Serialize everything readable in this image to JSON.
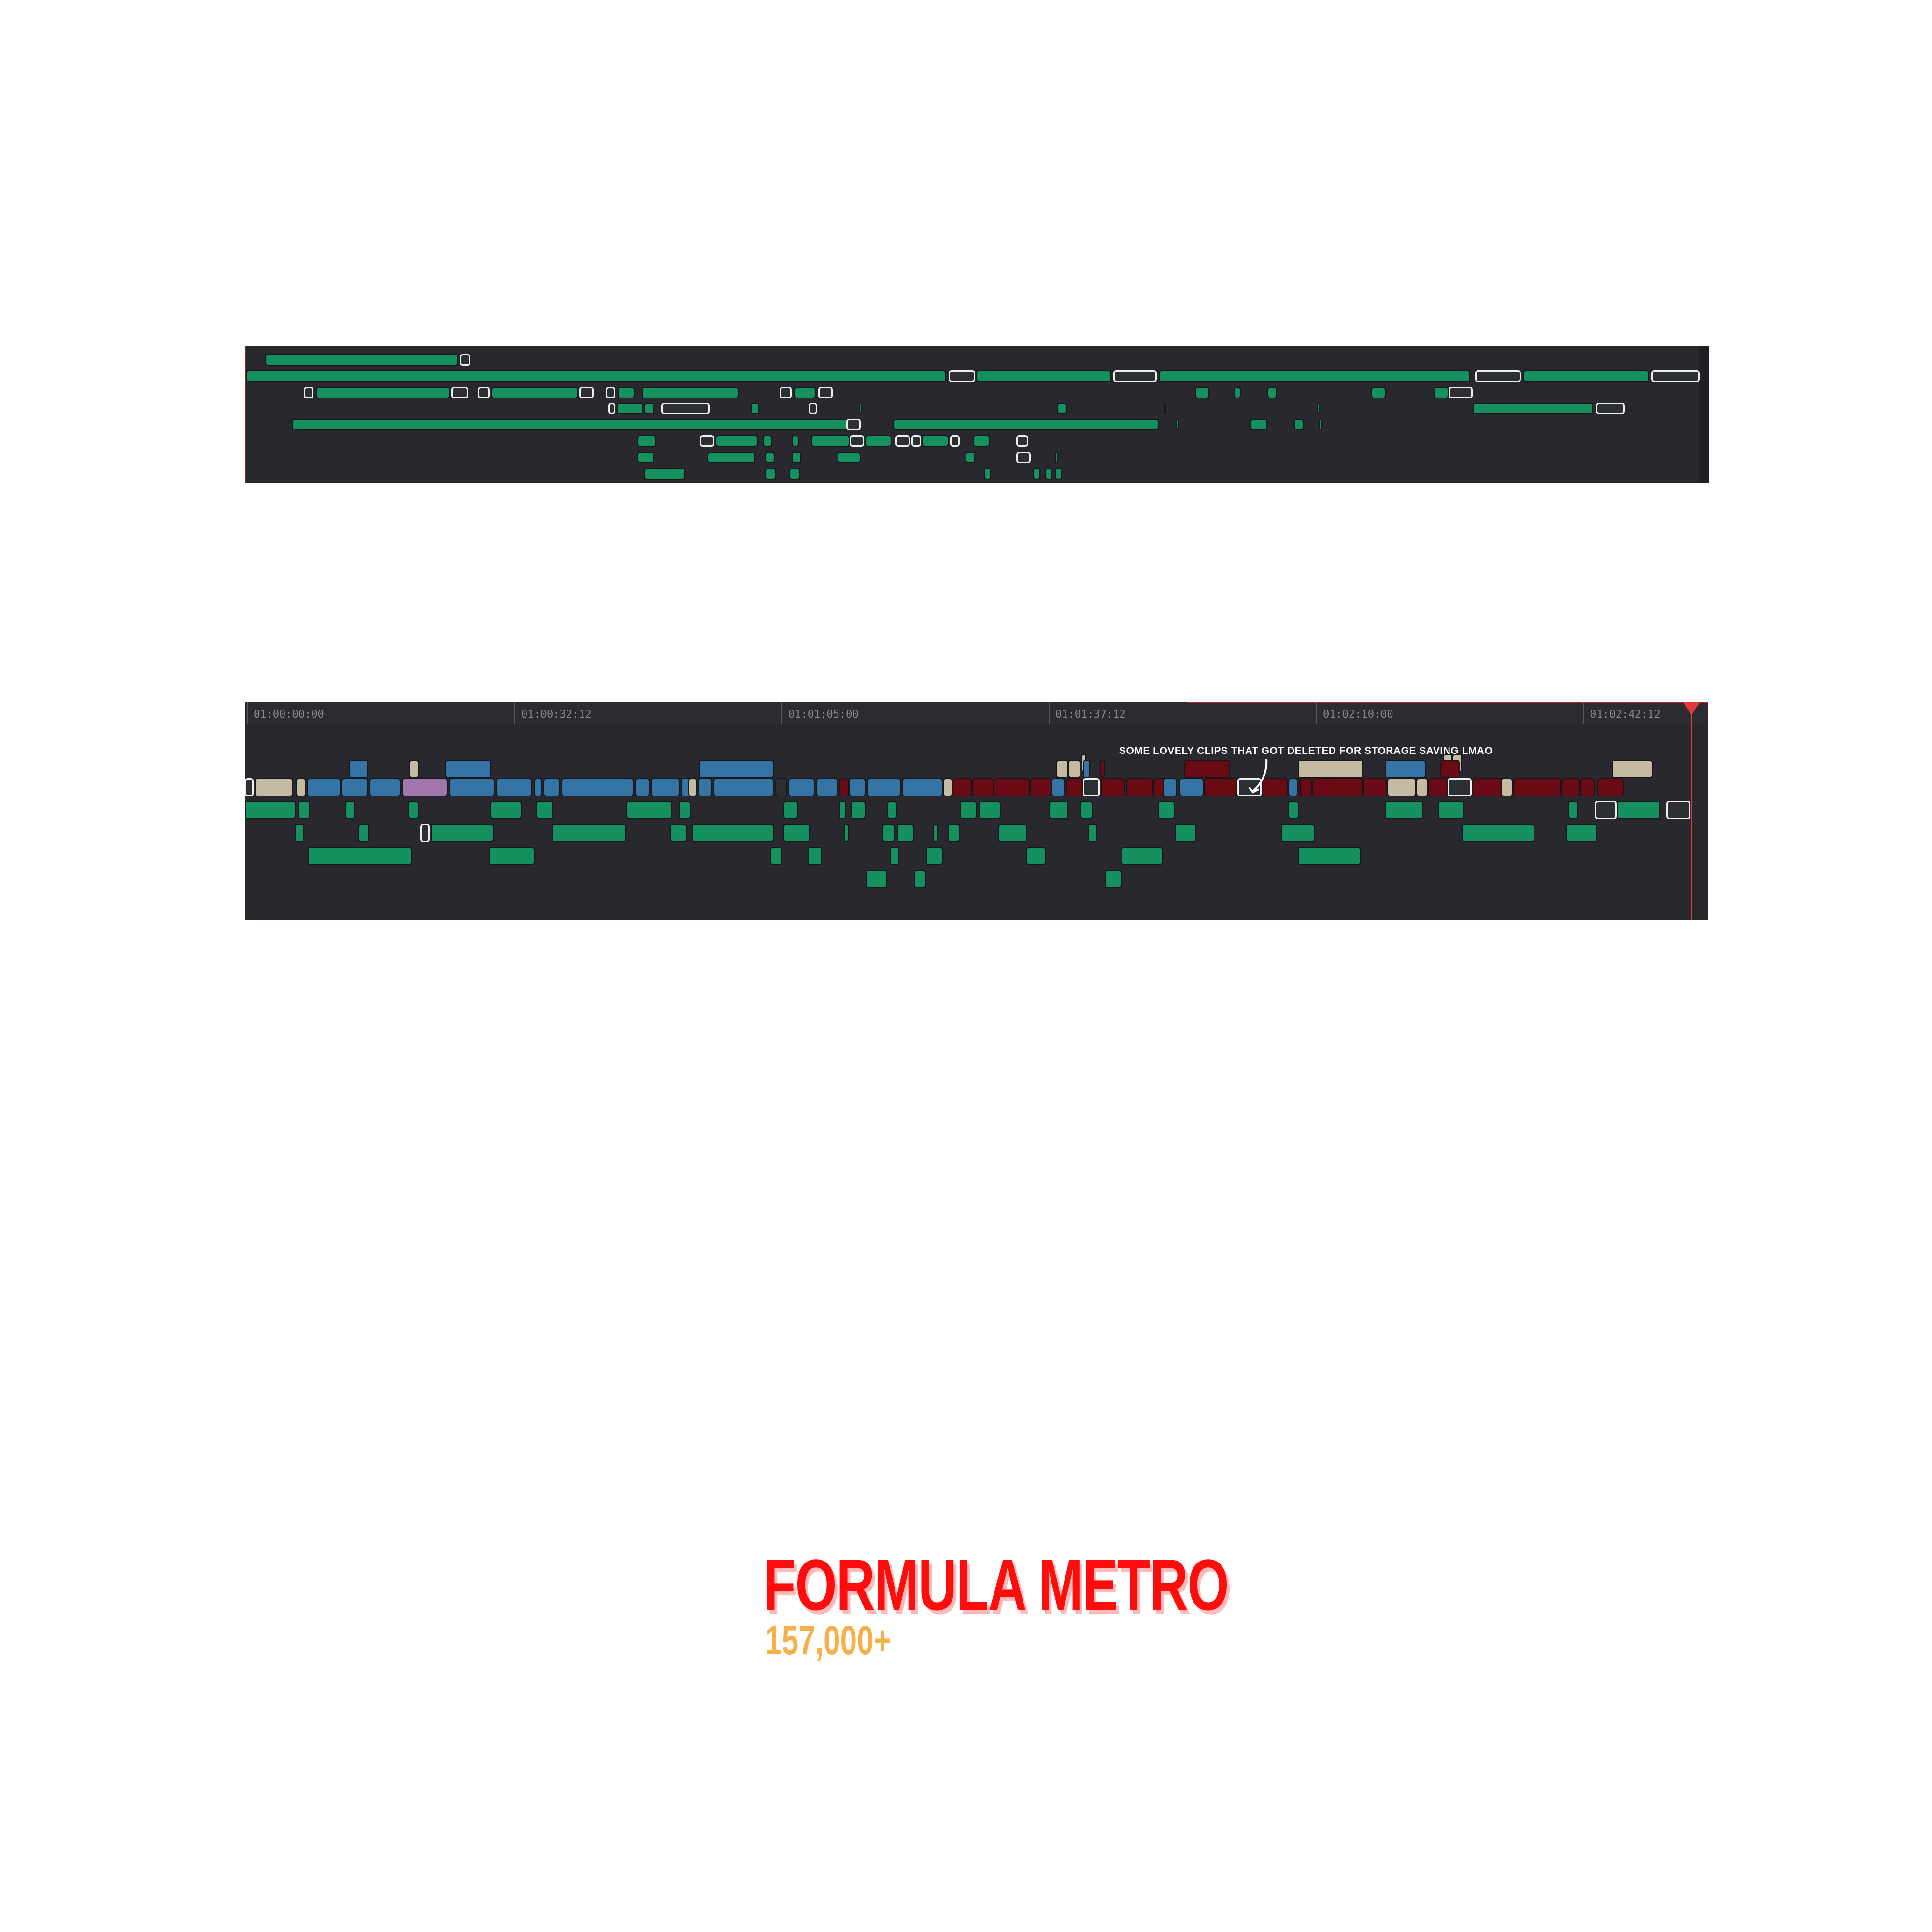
{
  "timeline_bottom": {
    "timecodes": [
      "01:00:00:00",
      "01:00:32:12",
      "01:01:05:00",
      "01:01:37:12",
      "01:02:10:00",
      "01:02:42:12"
    ],
    "annotation": "SOME LOVELY CLIPS THAT GOT DELETED FOR STORAGE SAVING LMAO"
  },
  "branding": {
    "title": "FORMULA METRO",
    "count": "157,000+"
  },
  "colors": {
    "timeline_bg": "#28282e",
    "clip_green": "#14915e",
    "clip_blue": "#3575a5",
    "clip_tan": "#c6baa2",
    "clip_purple": "#a275ac",
    "clip_red": "#690a14",
    "playhead": "#e23b3b",
    "brand_red": "#ff0d0d",
    "brand_orange": "#f5b04b"
  }
}
